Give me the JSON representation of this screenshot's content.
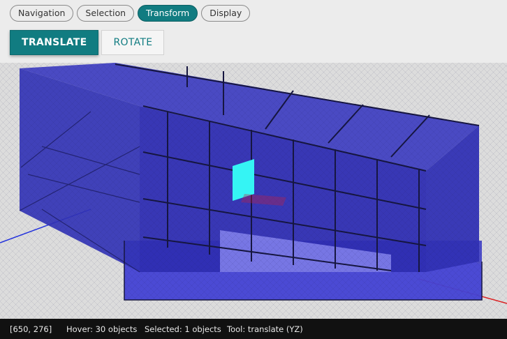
{
  "mode_tabs": [
    {
      "label": "Navigation",
      "active": false
    },
    {
      "label": "Selection",
      "active": false
    },
    {
      "label": "Transform",
      "active": true
    },
    {
      "label": "Display",
      "active": false
    }
  ],
  "transform_actions": {
    "translate_label": "TRANSLATE",
    "rotate_label": "ROTATE",
    "active": "translate"
  },
  "status": {
    "cursor": "[650, 276]",
    "hover": "Hover: 30 objects",
    "selected": "Selected: 1 objects",
    "tool": "Tool: translate (YZ)"
  },
  "colors": {
    "accent": "#117c81",
    "model_fill": "#2d2cc0",
    "gizmo_plane": "#35f4f4",
    "axis_x": "#e02020",
    "axis_z": "#2030e0"
  }
}
